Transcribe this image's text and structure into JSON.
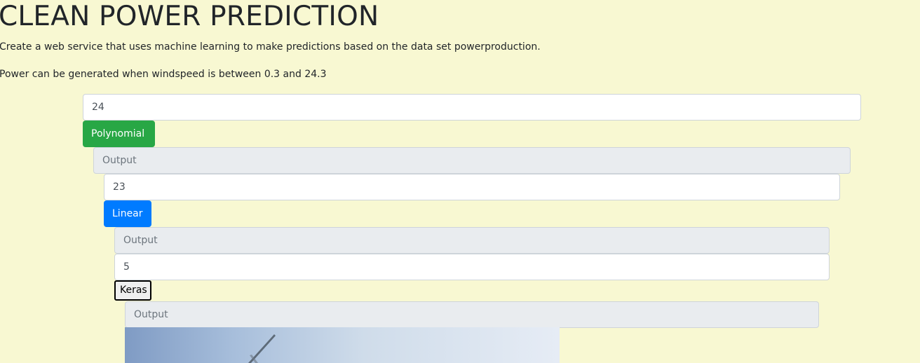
{
  "header": {
    "title": "CLEAN POWER PREDICTION",
    "description": "Create a web service that uses machine learning to make predictions based on the data set powerproduction.",
    "range_note": "Power can be generated when windspeed is between 0.3 and 24.3"
  },
  "polynomial": {
    "input_value": "24",
    "button_label": "Polynomial",
    "output_placeholder": "Output",
    "button_color": "#28a745"
  },
  "linear": {
    "input_value": "23",
    "button_label": "Linear",
    "output_placeholder": "Output",
    "button_color": "#007bff"
  },
  "keras": {
    "input_value": "5",
    "button_label": "Keras",
    "output_placeholder": "Output"
  },
  "image": {
    "icon": "wind-turbine-image"
  }
}
